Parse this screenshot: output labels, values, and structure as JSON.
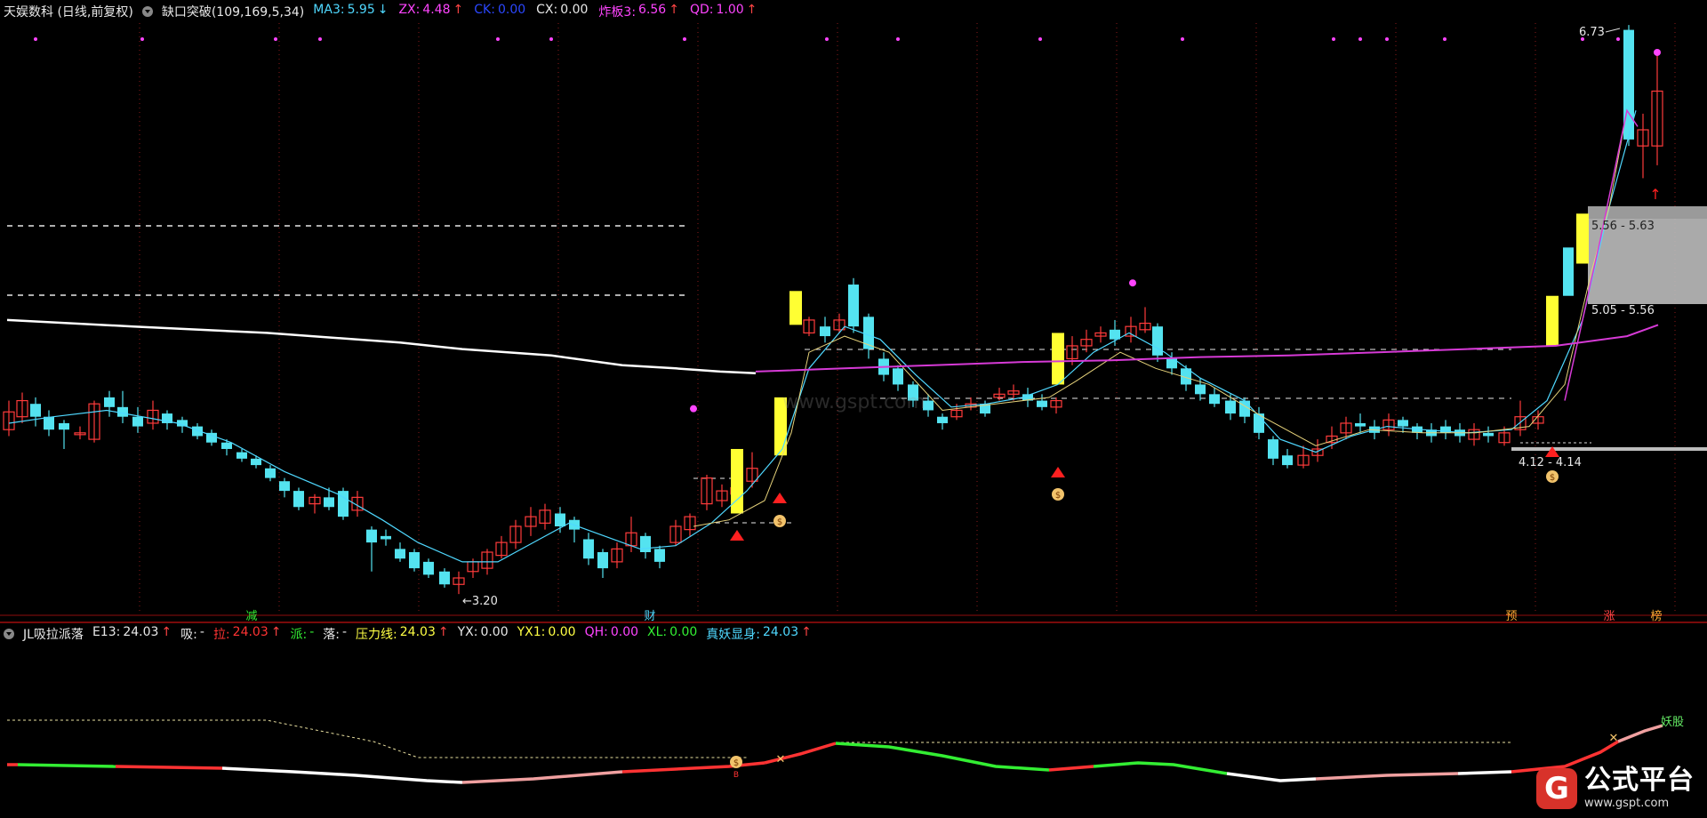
{
  "main_legend": {
    "title": "天娱数科 (日线,前复权)",
    "indicator": "缺口突破(109,169,5,34)",
    "items": [
      {
        "label": "MA3:",
        "value": "5.95",
        "arrow": "↓",
        "color": "#4fd8ff",
        "arrow_color": "#4fd8ff"
      },
      {
        "label": "ZX:",
        "value": "4.48",
        "arrow": "↑",
        "color": "#ff44ff",
        "arrow_color": "#ff4444"
      },
      {
        "label": "CK:",
        "value": "0.00",
        "arrow": "",
        "color": "#2b47ff",
        "arrow_color": ""
      },
      {
        "label": "CX:",
        "value": "0.00",
        "arrow": "",
        "color": "#e8e8e8",
        "arrow_color": ""
      },
      {
        "label": "炸板3:",
        "value": "6.56",
        "arrow": "↑",
        "color": "#ff44ff",
        "arrow_color": "#ff4444"
      },
      {
        "label": "QD:",
        "value": "1.00",
        "arrow": "↑",
        "color": "#ff44ff",
        "arrow_color": "#ff4444"
      }
    ]
  },
  "ind_legend": {
    "title": "JL吸拉派落",
    "items": [
      {
        "label": "E13:",
        "value": "24.03",
        "arrow": "↑",
        "color": "#e8e8e8",
        "arrow_color": "#ff4444"
      },
      {
        "label": "吸:",
        "value": "-",
        "arrow": "",
        "color": "#e8e8e8",
        "arrow_color": ""
      },
      {
        "label": "拉:",
        "value": "24.03",
        "arrow": "↑",
        "color": "#ff3333",
        "arrow_color": "#ff4444"
      },
      {
        "label": "派:",
        "value": "-",
        "arrow": "",
        "color": "#33ee33",
        "arrow_color": ""
      },
      {
        "label": "落:",
        "value": "-",
        "arrow": "",
        "color": "#e8e8e8",
        "arrow_color": ""
      },
      {
        "label": "压力线:",
        "value": "24.03",
        "arrow": "↑",
        "color": "#ffff44",
        "arrow_color": "#ff4444"
      },
      {
        "label": "YX:",
        "value": "0.00",
        "arrow": "",
        "color": "#e8e8e8",
        "arrow_color": ""
      },
      {
        "label": "YX1:",
        "value": "0.00",
        "arrow": "",
        "color": "#ffff44",
        "arrow_color": ""
      },
      {
        "label": "QH:",
        "value": "0.00",
        "arrow": "",
        "color": "#ff44ff",
        "arrow_color": ""
      },
      {
        "label": "XL:",
        "value": "0.00",
        "arrow": "",
        "color": "#33ee33",
        "arrow_color": ""
      },
      {
        "label": "真妖显身:",
        "value": "24.03",
        "arrow": "↑",
        "color": "#4fd8ff",
        "arrow_color": "#ff4444"
      }
    ]
  },
  "price_labels": {
    "high": "6.73",
    "low": "3.20",
    "zone_upper": "5.56 - 5.63",
    "zone_mid": "5.05 - 5.56",
    "zone_low": "4.12 - 4.14"
  },
  "bottom_markers": [
    {
      "text": "减",
      "color": "#33ee33"
    },
    {
      "text": "财",
      "color": "#4fd8ff"
    },
    {
      "text": "预",
      "color": "#ffaa33"
    },
    {
      "text": "涨",
      "color": "#ff4444"
    },
    {
      "text": "榜",
      "color": "#ffaa33"
    }
  ],
  "indicator_tag": "妖股",
  "site_watermark": "www.gspt.com",
  "watermark": {
    "logo": "G",
    "title": "公式平台",
    "url": "www.gspt.com"
  },
  "colors": {
    "bull": "#ff3b3b",
    "bear": "#54e3f0",
    "signal": "#ffff33",
    "ma": "#4fd8ff",
    "zx": "#d63ad6",
    "white_line": "#ffffff",
    "grid": "#8b1a1a",
    "separator": "#c01010"
  }
}
